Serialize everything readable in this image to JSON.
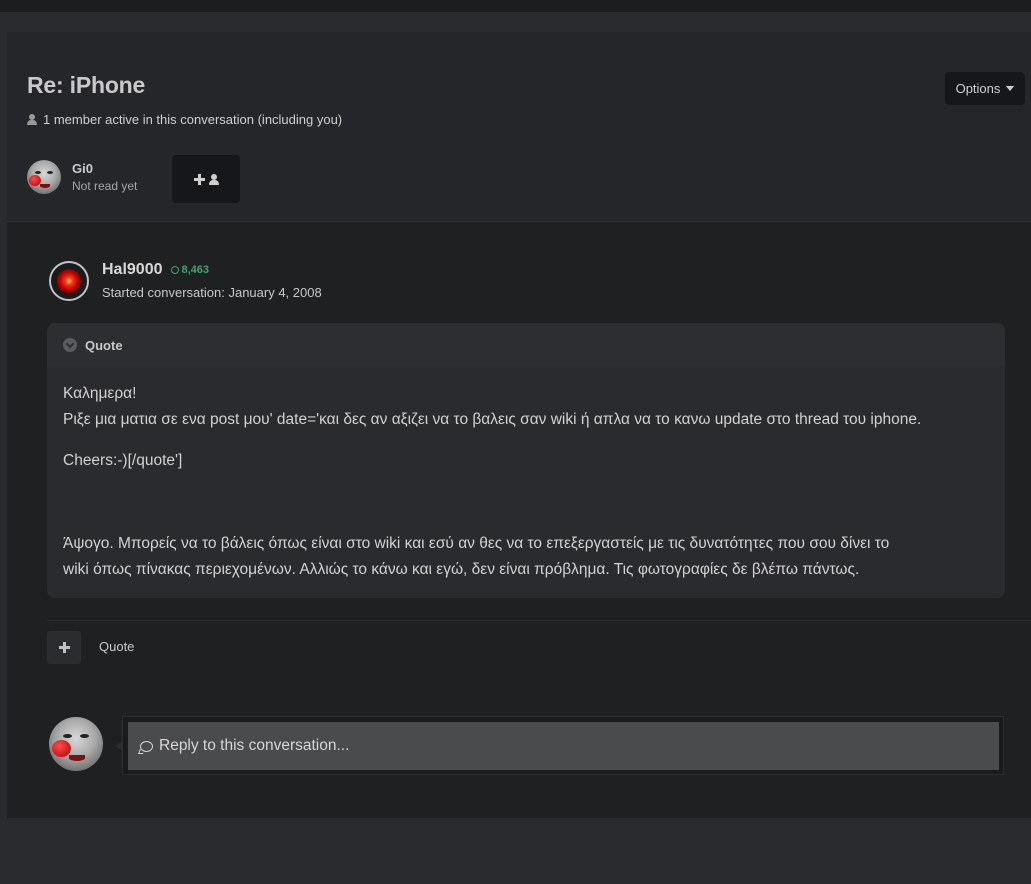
{
  "conversation": {
    "title": "Re: iPhone",
    "active_text": "1 member active in this conversation (including you)",
    "options_label": "Options"
  },
  "participants": [
    {
      "name": "Gi0",
      "status": "Not read yet"
    }
  ],
  "post": {
    "author": "Hal9000",
    "reputation": "8,463",
    "started": "Started conversation: January 4, 2008",
    "quote_label": "Quote",
    "lines": [
      "Καλημερα!",
      "Ριξε μια ματια σε ενα post μου' date='και δες αν αξιζει να το βαλεις σαν wiki ή απλα να το κανω update στο thread του iphone.",
      "Cheers:-)[/quote']",
      "Άψογο. Μπορείς να το βάλεις όπως είναι στο wiki και εσύ αν θες να το επεξεργαστείς με τις δυνατότητες που σου δίνει το",
      "wiki όπως πίνακας περιεχομένων. Αλλιώς το κάνω και εγώ, δεν είναι πρόβλημα. Τις φωτογραφίες δε βλέπω πάντως."
    ]
  },
  "actions": {
    "quote_link": "Quote"
  },
  "reply": {
    "placeholder": "Reply to this conversation..."
  },
  "colors": {
    "reputation": "#3fa56b",
    "background": "#1f2022"
  }
}
